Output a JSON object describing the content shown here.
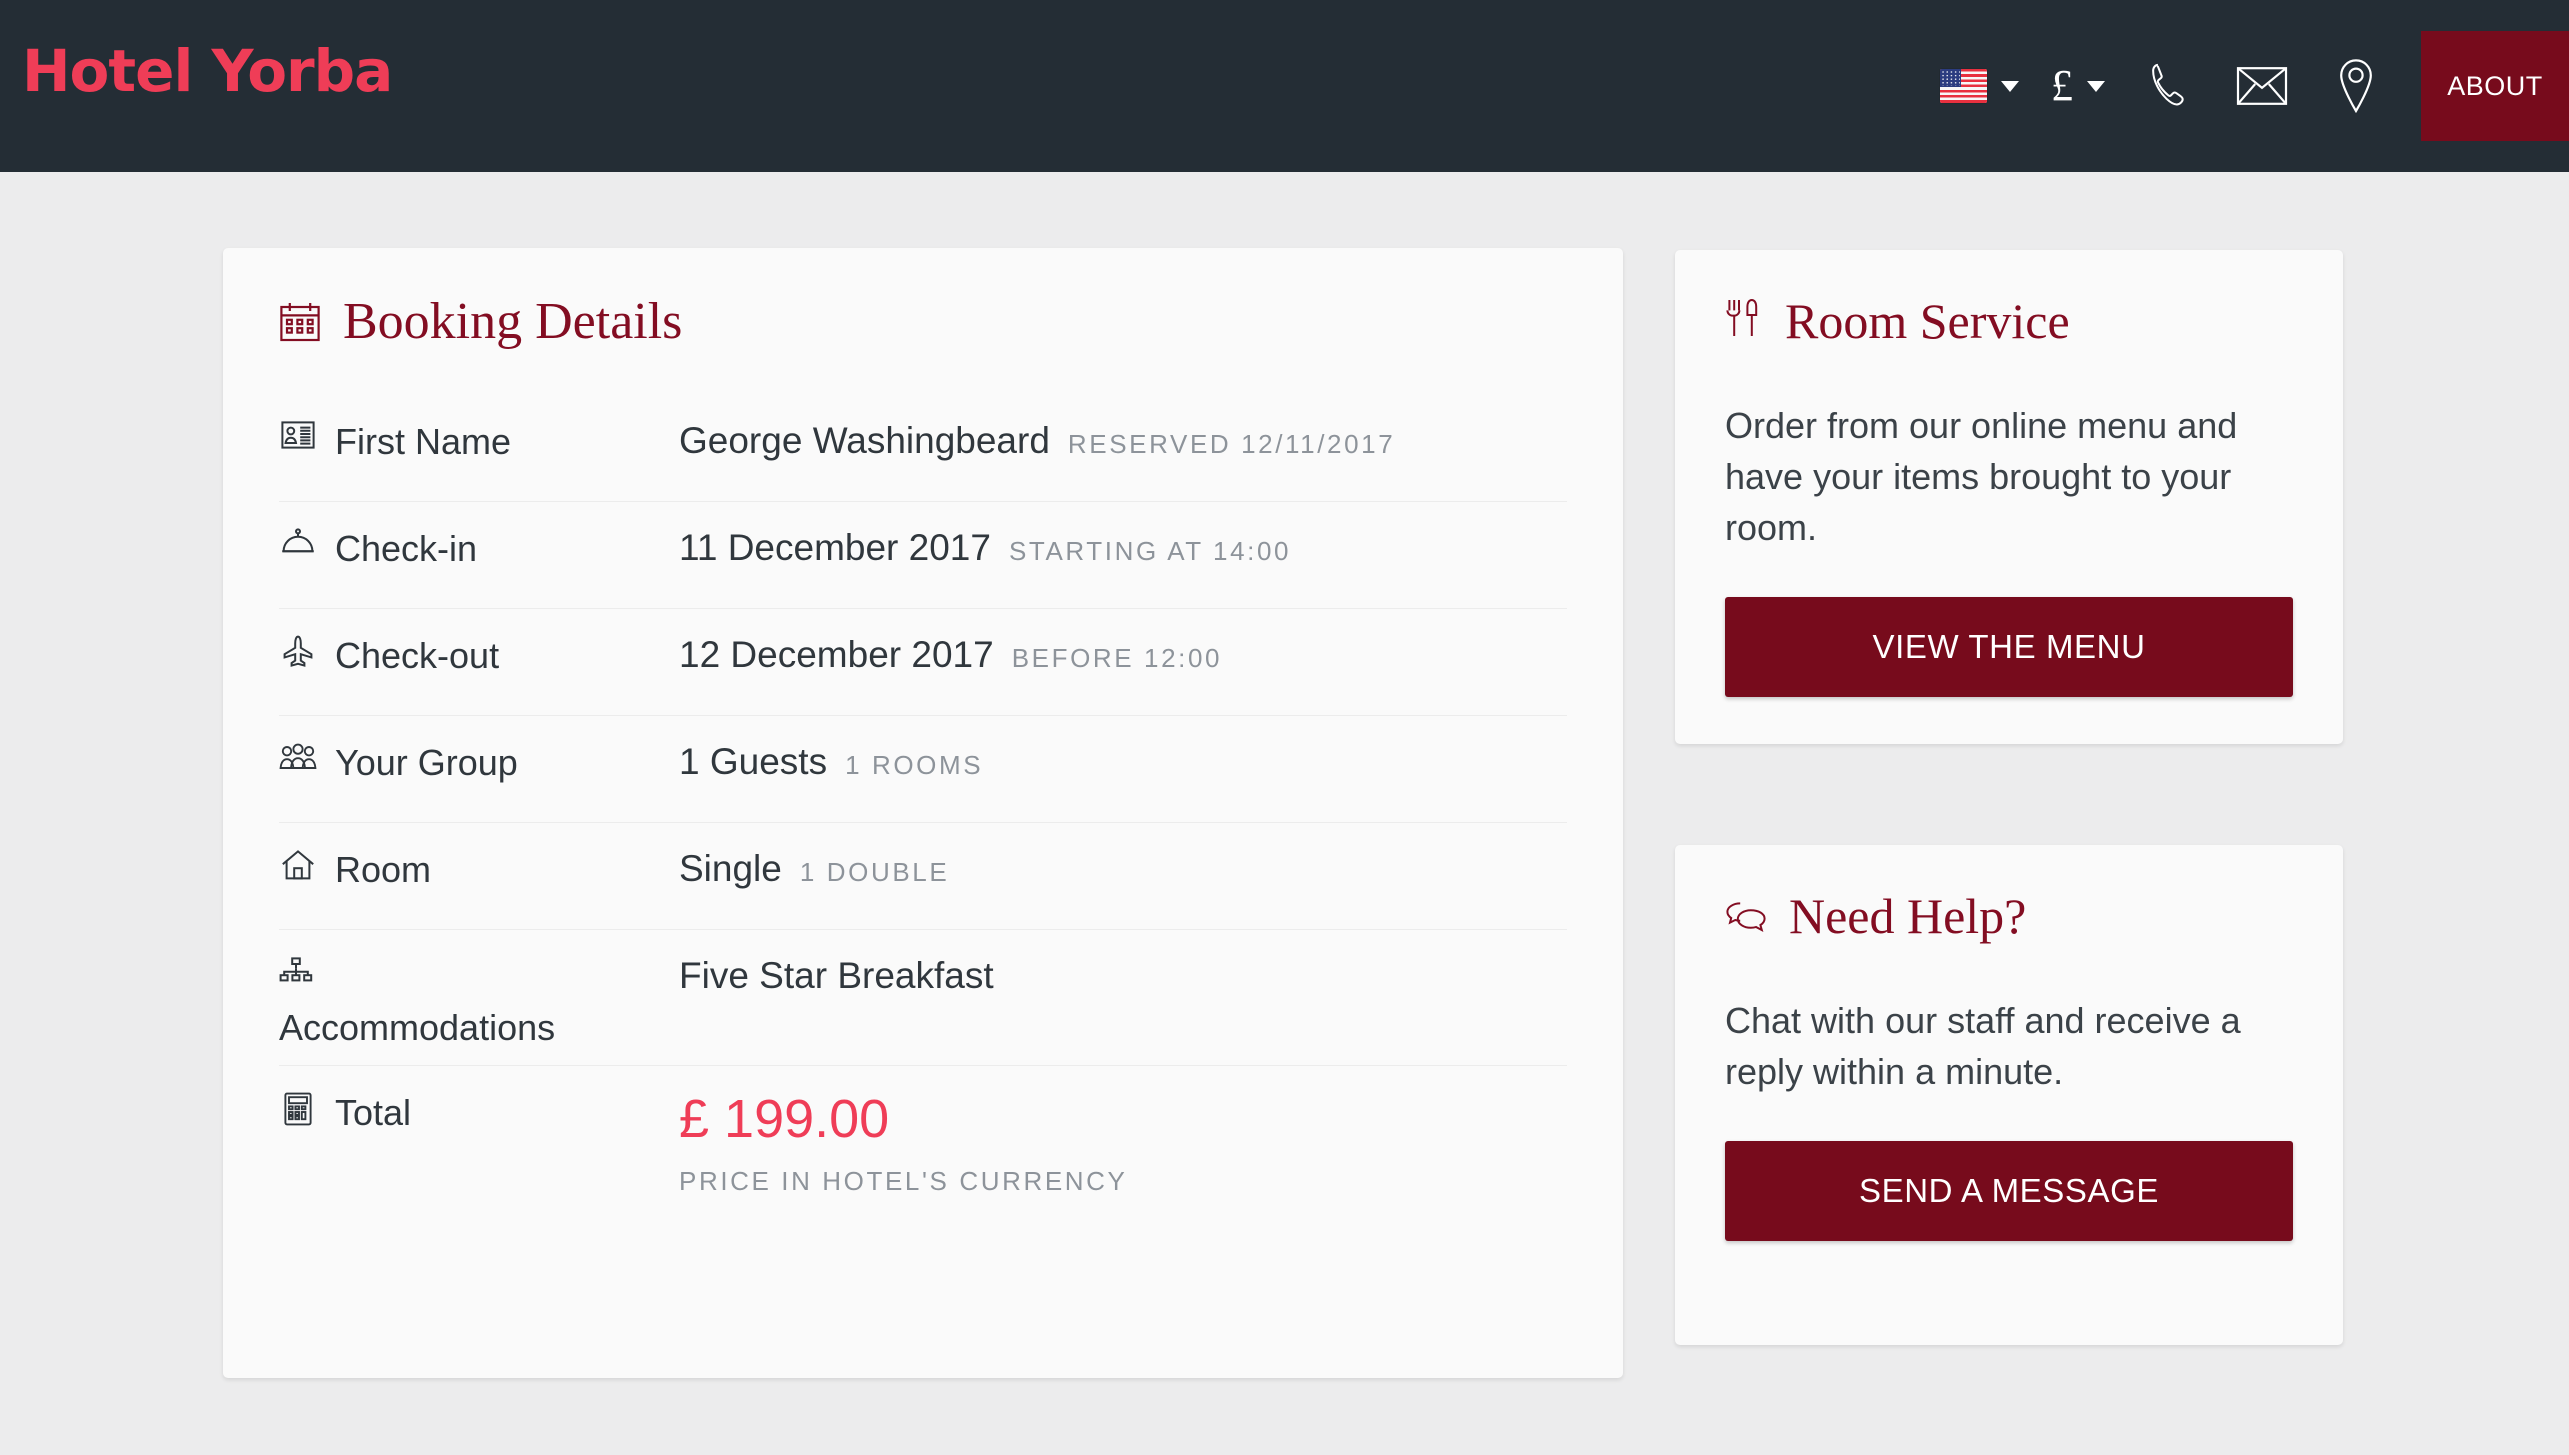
{
  "header": {
    "logo": "Hotel Yorba",
    "language_selector": {
      "name": "language-selector",
      "flag": "us-flag-icon",
      "caret": "chevron-down-icon"
    },
    "currency_selector": {
      "symbol": "£",
      "caret": "chevron-down-icon"
    },
    "icons": [
      {
        "name": "phone-icon",
        "label": "Phone"
      },
      {
        "name": "envelope-icon",
        "label": "Email"
      },
      {
        "name": "map-pin-icon",
        "label": "Location"
      }
    ],
    "about_label": "ABOUT"
  },
  "booking": {
    "title": "Booking Details",
    "title_icon": "calendar-icon",
    "rows": [
      {
        "icon": "id-card-icon",
        "label": "First Name",
        "value": "George Washingbeard",
        "meta": "RESERVED 12/11/2017"
      },
      {
        "icon": "service-bell-icon",
        "label": "Check-in",
        "value": "11 December 2017",
        "meta": "STARTING AT 14:00"
      },
      {
        "icon": "airplane-icon",
        "label": "Check-out",
        "value": "12 December 2017",
        "meta": "BEFORE 12:00"
      },
      {
        "icon": "group-icon",
        "label": "Your Group",
        "value": "1 Guests",
        "meta": "1 ROOMS"
      },
      {
        "icon": "home-icon",
        "label": "Room",
        "value": "Single",
        "meta": "1 DOUBLE"
      },
      {
        "icon": "sitemap-icon",
        "label": "Accommodations",
        "value": "Five Star Breakfast",
        "meta": ""
      }
    ],
    "total": {
      "icon": "calculator-icon",
      "label": "Total",
      "price": "£ 199.00",
      "note": "PRICE IN HOTEL'S CURRENCY"
    }
  },
  "sidebar": {
    "room_service": {
      "title": "Room Service",
      "title_icon": "fork-knife-icon",
      "body": "Order from our online menu and have your items brought to your room.",
      "cta": "VIEW THE MENU"
    },
    "need_help": {
      "title": "Need Help?",
      "title_icon": "chat-bubbles-icon",
      "body": "Chat with our staff and receive a reply within a minute.",
      "cta": "SEND A MESSAGE"
    }
  },
  "colors": {
    "header_bg": "#242d35",
    "brand_pink": "#ef3d57",
    "brand_dark_red": "#770b1c",
    "title_red": "#830d22",
    "page_bg": "#ececed",
    "card_bg": "#fafafa",
    "meta_gray": "#8d939a"
  }
}
